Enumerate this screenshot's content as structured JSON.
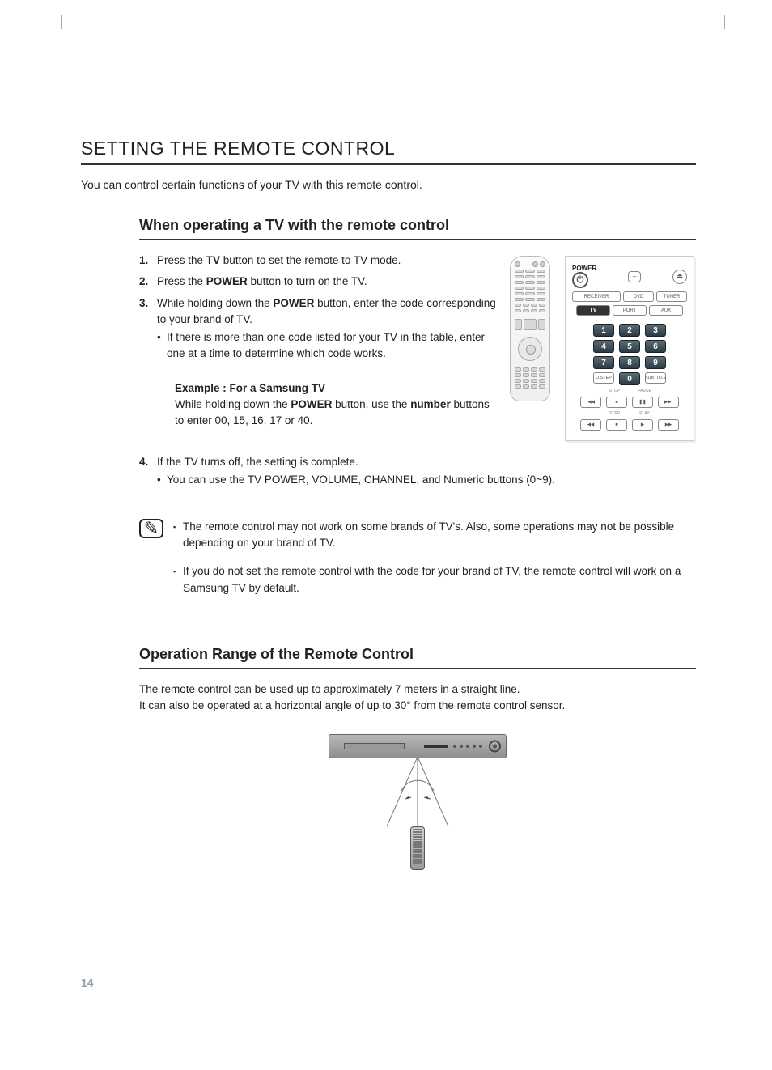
{
  "page_number": "14",
  "section_title": "SETTING THE REMOTE CONTROL",
  "intro": "You can control certain functions of your TV with this remote control.",
  "sub1": {
    "title": "When operating a TV with the remote control",
    "step1_a": "Press the ",
    "step1_b": "TV",
    "step1_c": " button to set the remote to TV mode.",
    "step2_a": "Press the ",
    "step2_b": "POWER",
    "step2_c": " button to turn on the TV.",
    "step3_a": "While holding down the ",
    "step3_b": "POWER",
    "step3_c": " button, enter the code corresponding to your brand of TV.",
    "step3_bullet": "If there is more than one code listed for your TV in the table, enter one at a time to determine which code works.",
    "example_title": "Example : For a Samsung TV",
    "example_a": "While holding down the ",
    "example_b": "POWER",
    "example_c": " button, use the ",
    "example_d": "number",
    "example_e": " buttons to enter 00, 15, 16, 17 or 40.",
    "step4": "If the TV turns off, the setting is complete.",
    "step4_bullet": "You can use the TV POWER, VOLUME, CHANNEL, and Numeric buttons (0~9).",
    "note1": "The remote control may not work on some brands of TV's. Also, some operations may not be possible depending on your brand of TV.",
    "note2": "If you do not set the remote control with the code for your brand of TV, the remote control will work on a Samsung TV by default."
  },
  "sub2": {
    "title": "Operation Range of the Remote Control",
    "body1": "The remote control can be used up to approximately 7 meters in a straight line.",
    "body2": "It can also be operated at a horizontal angle of up to 30° from the remote control sensor."
  },
  "remote": {
    "power_label": "POWER",
    "receiver": "RECEIVER",
    "dvd": "DVD",
    "tuner": "TUNER",
    "tv": "TV",
    "port": "PORT",
    "aux": "AUX",
    "numbers": [
      "1",
      "2",
      "3",
      "4",
      "5",
      "6",
      "7",
      "8",
      "9",
      "0"
    ],
    "dstep": "D.STEP",
    "subtitle": "SUBTITLE",
    "stop": "STOP",
    "pause": "PAUSE",
    "step": "STEP",
    "play": "PLAY",
    "power_sym": "⏻",
    "dash": "–",
    "eject": "⏏",
    "prev": "|◀◀",
    "stop_sym": "■",
    "pause_sym": "❚❚",
    "next": "▶▶|",
    "rew": "◀◀",
    "stop2": "■",
    "play_sym": "▶",
    "ff": "▶▶"
  }
}
